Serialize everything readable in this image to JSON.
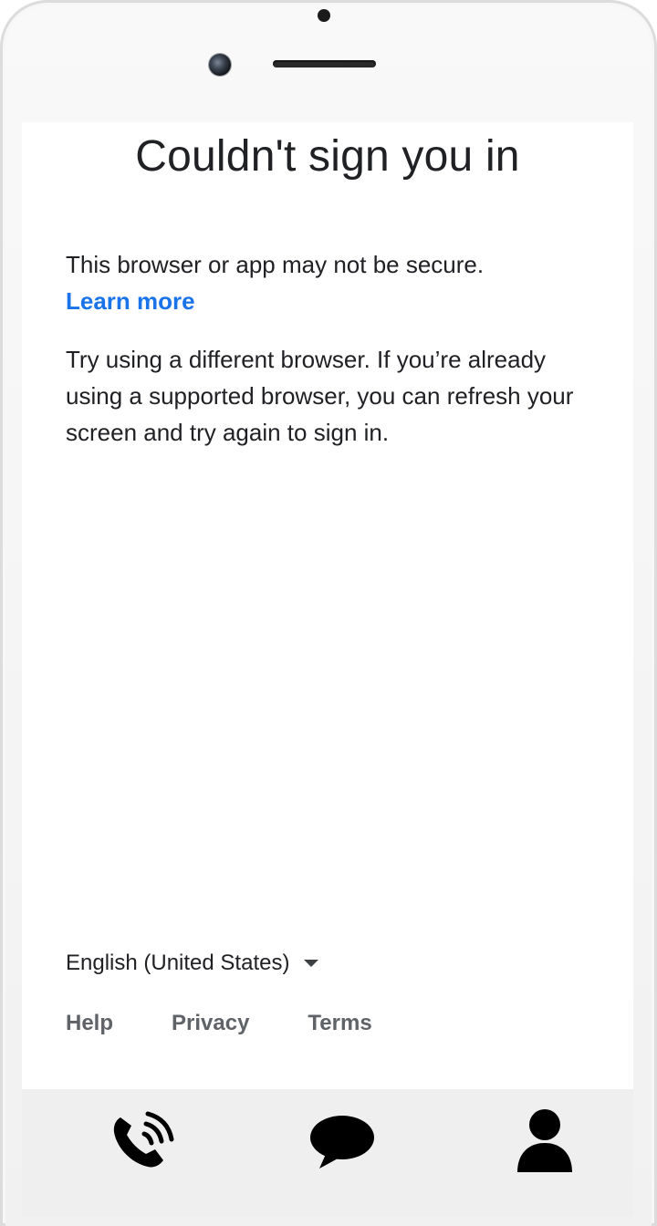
{
  "screen": {
    "title": "Couldn't sign you in",
    "message_secure": "This browser or app may not be secure.",
    "learn_more": "Learn more",
    "message_try": "Try using a different browser. If you’re already using a supported browser, you can refresh your screen and try again to sign in."
  },
  "footer": {
    "language": "English (United States)",
    "links": [
      "Help",
      "Privacy",
      "Terms"
    ]
  },
  "bottom_bar": {
    "icons": [
      "phone-call-icon",
      "chat-bubble-icon",
      "person-icon"
    ]
  },
  "colors": {
    "link": "#1a73e8",
    "text": "#202124",
    "muted": "#5f6368",
    "bar_bg": "#efefef"
  }
}
